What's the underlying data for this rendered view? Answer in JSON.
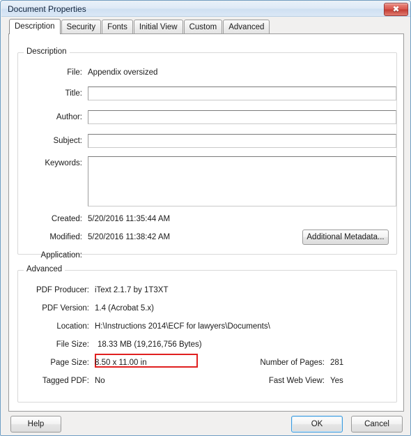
{
  "window": {
    "title": "Document Properties",
    "close_label": "✖"
  },
  "tabs": [
    {
      "label": "Description",
      "active": true
    },
    {
      "label": "Security",
      "active": false
    },
    {
      "label": "Fonts",
      "active": false
    },
    {
      "label": "Initial View",
      "active": false
    },
    {
      "label": "Custom",
      "active": false
    },
    {
      "label": "Advanced",
      "active": false
    }
  ],
  "description_group": {
    "title": "Description",
    "file": {
      "label": "File:",
      "value": "Appendix oversized"
    },
    "title_field": {
      "label": "Title:",
      "value": "",
      "placeholder": ""
    },
    "author_field": {
      "label": "Author:",
      "value": "",
      "placeholder": ""
    },
    "subject_field": {
      "label": "Subject:",
      "value": "",
      "placeholder": ""
    },
    "keywords_field": {
      "label": "Keywords:",
      "value": "",
      "placeholder": ""
    },
    "created": {
      "label": "Created:",
      "value": "5/20/2016 11:35:44 AM"
    },
    "modified": {
      "label": "Modified:",
      "value": "5/20/2016 11:38:42 AM"
    },
    "application": {
      "label": "Application:",
      "value": ""
    },
    "additional_metadata_button": "Additional Metadata..."
  },
  "advanced_group": {
    "title": "Advanced",
    "pdf_producer": {
      "label": "PDF Producer:",
      "value": "iText 2.1.7 by 1T3XT"
    },
    "pdf_version": {
      "label": "PDF Version:",
      "value": "1.4 (Acrobat 5.x)"
    },
    "location": {
      "label": "Location:",
      "value": "H:\\Instructions 2014\\ECF for lawyers\\Documents\\"
    },
    "file_size": {
      "label": "File Size:",
      "value": "18.33 MB (19,216,756 Bytes)"
    },
    "page_size": {
      "label": "Page Size:",
      "value": "8.50 x 11.00 in"
    },
    "tagged_pdf": {
      "label": "Tagged PDF:",
      "value": "No"
    },
    "number_of_pages": {
      "label": "Number of Pages:",
      "value": "281"
    },
    "fast_web_view": {
      "label": "Fast Web View:",
      "value": "Yes"
    }
  },
  "footer": {
    "help": "Help",
    "ok": "OK",
    "cancel": "Cancel"
  },
  "annotation": {
    "highlight_color": "#e02020",
    "highlight_target": "file_size"
  }
}
